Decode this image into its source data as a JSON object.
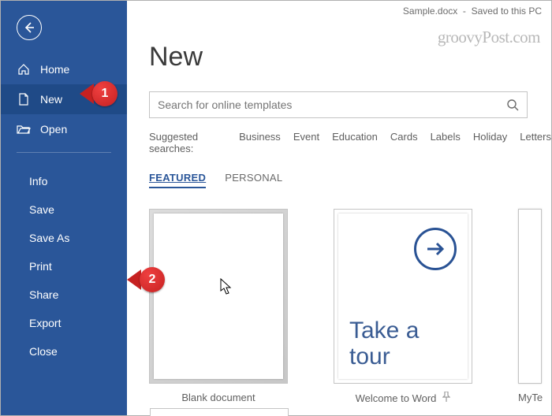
{
  "topbar": {
    "doc_name": "Sample.docx",
    "status": "Saved to this PC"
  },
  "watermark": "groovyPost.com",
  "page_title": "New",
  "sidebar": {
    "home": "Home",
    "new": "New",
    "open": "Open",
    "info": "Info",
    "save": "Save",
    "saveas": "Save As",
    "print": "Print",
    "share": "Share",
    "export": "Export",
    "close": "Close"
  },
  "search": {
    "placeholder": "Search for online templates"
  },
  "suggested": {
    "label": "Suggested searches:",
    "items": [
      "Business",
      "Event",
      "Education",
      "Cards",
      "Labels",
      "Holiday",
      "Letters"
    ]
  },
  "tabs": {
    "featured": "FEATURED",
    "personal": "PERSONAL"
  },
  "templates": {
    "blank": "Blank document",
    "tour_label": "Welcome to Word",
    "tour_line1": "Take a",
    "tour_line2": "tour",
    "third": "MyTe"
  },
  "callouts": {
    "one": "1",
    "two": "2"
  },
  "colors": {
    "brand": "#2a5699",
    "callout": "#c62121"
  }
}
